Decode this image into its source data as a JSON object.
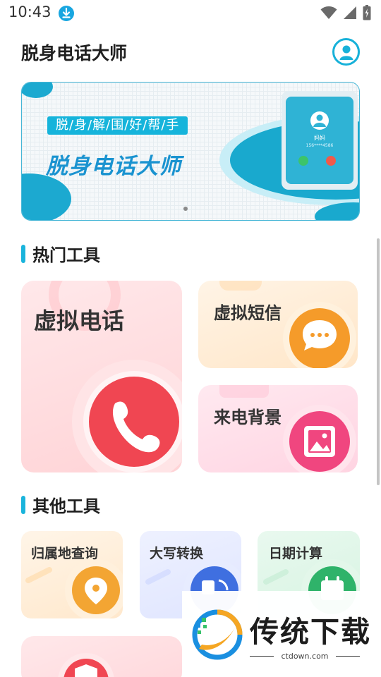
{
  "status": {
    "time": "10:43"
  },
  "header": {
    "title": "脱身电话大师"
  },
  "banner": {
    "tag": "脱/身/解/围/好/帮/手",
    "title": "脱身电话大师",
    "caller": "妈妈",
    "number": "156****4586"
  },
  "hot_tools": {
    "title": "热门工具",
    "items": [
      {
        "label": "虚拟电话",
        "icon": "phone-icon",
        "color": "#f04652"
      },
      {
        "label": "虚拟短信",
        "icon": "message-icon",
        "color": "#f59b2a"
      },
      {
        "label": "来电背景",
        "icon": "image-icon",
        "color": "#f0467f"
      }
    ]
  },
  "other_tools": {
    "title": "其他工具",
    "items": [
      {
        "label": "归属地查询",
        "icon": "location-icon",
        "color": "#f3a533"
      },
      {
        "label": "大写转换",
        "icon": "convert-icon",
        "color": "#3f6fe0"
      },
      {
        "label": "日期计算",
        "icon": "calendar-icon",
        "color": "#2fb36a"
      }
    ]
  },
  "watermark": {
    "text": "传统下载",
    "url": "ctdown.com"
  }
}
